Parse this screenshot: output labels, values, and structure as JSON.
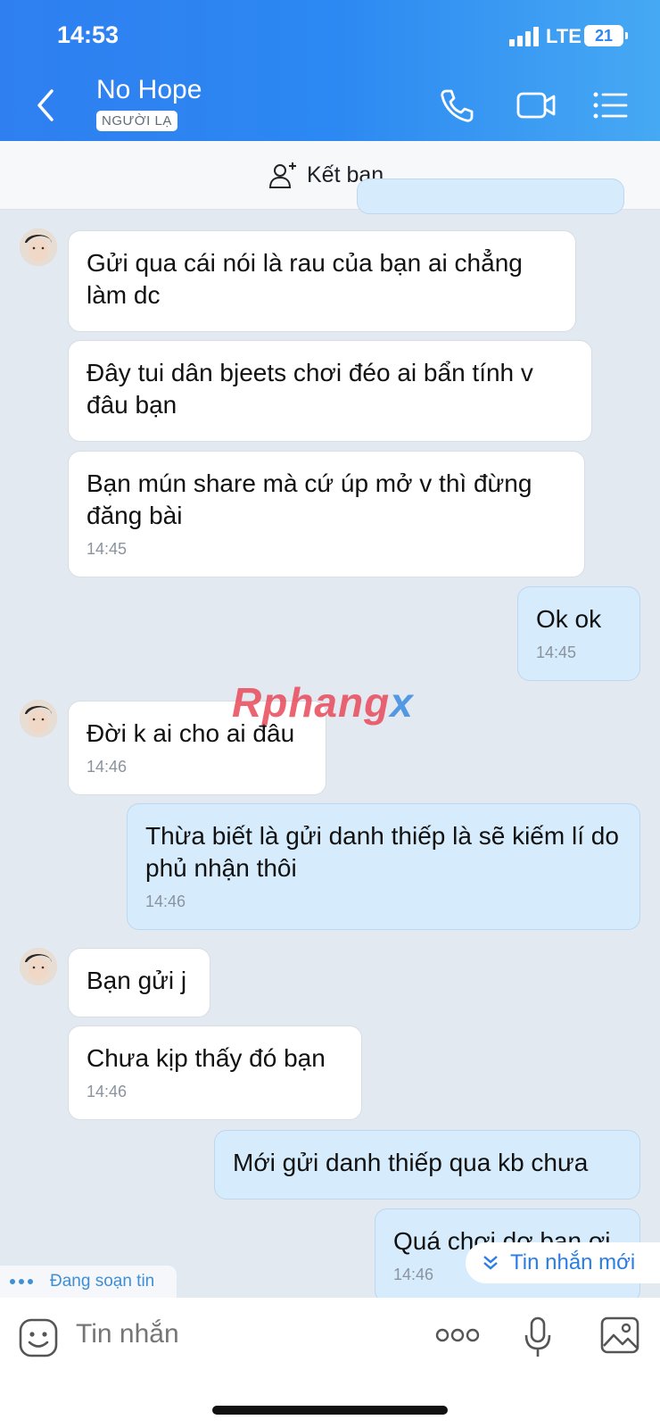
{
  "status_bar": {
    "time": "14:53",
    "network": "LTE",
    "battery": "21"
  },
  "header": {
    "contact_name": "No Hope",
    "badge": "NGƯỜI LẠ"
  },
  "add_friend": {
    "label": "Kết bạn"
  },
  "messages": [
    {
      "text": "Gửi qua cái nói là rau của bạn ai chẳng làm dc",
      "time": ""
    },
    {
      "text": "Đây tui dân bjeets chơi đéo ai bẩn tính v đâu bạn",
      "time": ""
    },
    {
      "text": "Bạn mún share mà cứ úp mở v thì đừng đăng bài",
      "time": "14:45"
    },
    {
      "text": "Ok ok",
      "time": "14:45"
    },
    {
      "text": "Đời k ai cho ai đâu",
      "time": "14:46"
    },
    {
      "text": "Thừa biết là gửi danh thiếp là sẽ kiếm lí do phủ nhận thôi",
      "time": "14:46"
    },
    {
      "text": "Bạn gửi j",
      "time": ""
    },
    {
      "text": "Chưa kịp thấy đó bạn",
      "time": "14:46"
    },
    {
      "text": "Mới gửi danh thiếp qua kb chưa",
      "time": ""
    },
    {
      "text": "Quá chơi dơ bạn ơi",
      "time": "14:46"
    }
  ],
  "watermark": {
    "part1": "Rphang",
    "part2": "x"
  },
  "typing_indicator": "Đang soạn tin",
  "new_message_button": "Tin nhắn mới",
  "input": {
    "placeholder": "Tin nhắn"
  },
  "colors": {
    "header_start": "#2f7ff0",
    "header_end": "#46a9f3",
    "outgoing_bubble": "#d6ecfd",
    "incoming_bubble": "#ffffff",
    "chat_background": "#e3e9f1"
  },
  "icons": [
    "back-icon",
    "phone-icon",
    "video-icon",
    "menu-icon",
    "add-friend-icon",
    "sticker-icon",
    "more-icon",
    "microphone-icon",
    "image-icon",
    "chevron-down-double-icon"
  ]
}
